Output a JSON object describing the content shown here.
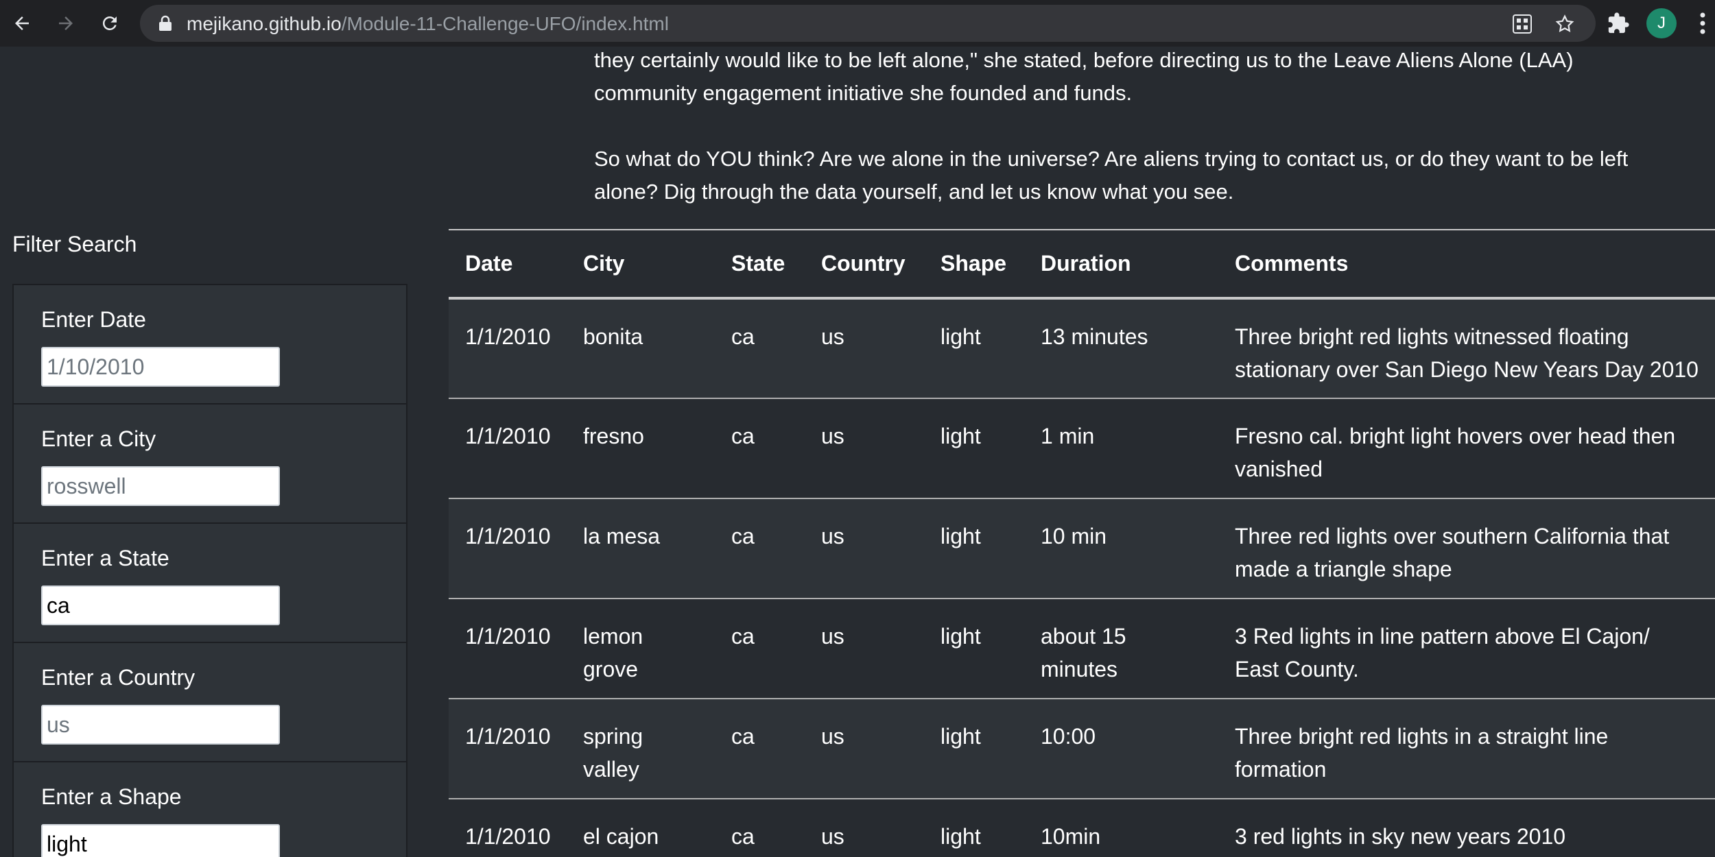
{
  "browser": {
    "url_host": "mejikano.github.io",
    "url_path": "/Module-11-Challenge-UFO/index.html",
    "profile_initial": "J",
    "profile_color": "#1e8a6b",
    "icons": [
      "back-arrow-icon",
      "forward-arrow-icon",
      "reload-icon",
      "lock-icon",
      "app-grid-icon",
      "bookmark-star-icon",
      "extensions-puzzle-icon",
      "kebab-menu-icon"
    ]
  },
  "intro": {
    "paragraph1_line1": "they certainly would like to be left alone,\" she stated, before directing us to the Leave Aliens Alone (LAA)",
    "paragraph1_line2": "community engagement initiative she founded and funds.",
    "paragraph2_line1": "So what do YOU think? Are we alone in the universe? Are aliens trying to contact us, or do they want to be left",
    "paragraph2_line2": "alone? Dig through the data yourself, and let us know what you see."
  },
  "filter": {
    "title": "Filter Search",
    "fields": [
      {
        "label": "Enter Date",
        "value": "",
        "placeholder": "1/10/2010"
      },
      {
        "label": "Enter a City",
        "value": "",
        "placeholder": "rosswell"
      },
      {
        "label": "Enter a State",
        "value": "ca",
        "placeholder": ""
      },
      {
        "label": "Enter a Country",
        "value": "",
        "placeholder": "us"
      },
      {
        "label": "Enter a Shape",
        "value": "light",
        "placeholder": ""
      }
    ]
  },
  "table": {
    "headers": [
      "Date",
      "City",
      "State",
      "Country",
      "Shape",
      "Duration",
      "Comments"
    ],
    "rows": [
      [
        "1/1/2010",
        "bonita",
        "ca",
        "us",
        "light",
        "13 minutes",
        "Three bright red lights witnessed floating stationary over San Diego New Years Day 2010"
      ],
      [
        "1/1/2010",
        "fresno",
        "ca",
        "us",
        "light",
        "1 min",
        "Fresno cal. bright light hovers over head then vanished"
      ],
      [
        "1/1/2010",
        "la mesa",
        "ca",
        "us",
        "light",
        "10 min",
        "Three red lights over southern California that made a triangle shape"
      ],
      [
        "1/1/2010",
        "lemon grove",
        "ca",
        "us",
        "light",
        "about 15 minutes",
        "3 Red lights in line pattern above El Cajon/ East County."
      ],
      [
        "1/1/2010",
        "spring valley",
        "ca",
        "us",
        "light",
        "10:00",
        "Three bright red lights in a straight line formation"
      ],
      [
        "1/1/2010",
        "el cajon",
        "ca",
        "us",
        "light",
        "10min",
        "3 red lights in sky new years 2010"
      ]
    ]
  }
}
